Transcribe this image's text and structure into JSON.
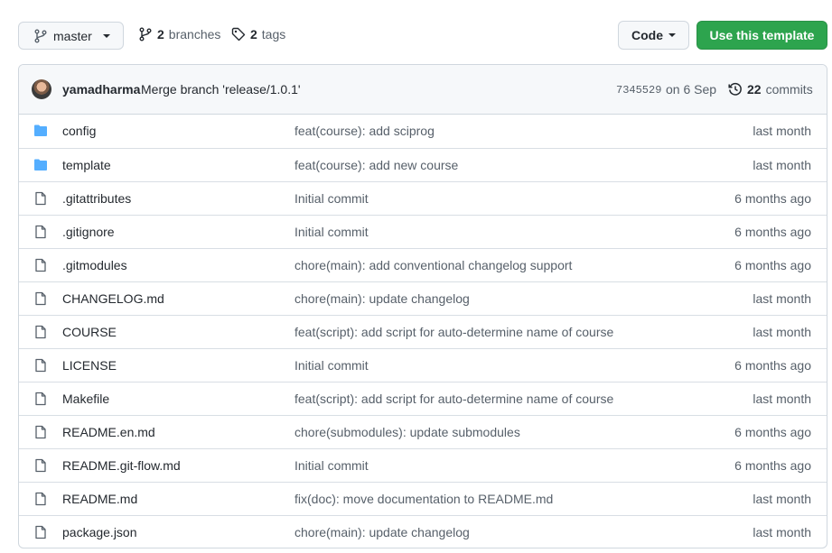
{
  "toolbar": {
    "branch": "master",
    "branches_count": "2",
    "branches_label": "branches",
    "tags_count": "2",
    "tags_label": "tags",
    "code_label": "Code",
    "template_label": "Use this template"
  },
  "latest_commit": {
    "author": "yamadharma",
    "message": "Merge branch 'release/1.0.1'",
    "sha": "7345529",
    "date": "on 6 Sep",
    "commits_count": "22",
    "commits_label": "commits"
  },
  "files": [
    {
      "name": "config",
      "type": "folder",
      "message": "feat(course): add sciprog",
      "age": "last month"
    },
    {
      "name": "template",
      "type": "folder",
      "message": "feat(course): add new course",
      "age": "last month"
    },
    {
      "name": ".gitattributes",
      "type": "file",
      "message": "Initial commit",
      "age": "6 months ago"
    },
    {
      "name": ".gitignore",
      "type": "file",
      "message": "Initial commit",
      "age": "6 months ago"
    },
    {
      "name": ".gitmodules",
      "type": "file",
      "message": "chore(main): add conventional changelog support",
      "age": "6 months ago"
    },
    {
      "name": "CHANGELOG.md",
      "type": "file",
      "message": "chore(main): update changelog",
      "age": "last month"
    },
    {
      "name": "COURSE",
      "type": "file",
      "message": "feat(script): add script for auto-determine name of course",
      "age": "last month"
    },
    {
      "name": "LICENSE",
      "type": "file",
      "message": "Initial commit",
      "age": "6 months ago"
    },
    {
      "name": "Makefile",
      "type": "file",
      "message": "feat(script): add script for auto-determine name of course",
      "age": "last month"
    },
    {
      "name": "README.en.md",
      "type": "file",
      "message": "chore(submodules): update submodules",
      "age": "6 months ago"
    },
    {
      "name": "README.git-flow.md",
      "type": "file",
      "message": "Initial commit",
      "age": "6 months ago"
    },
    {
      "name": "README.md",
      "type": "file",
      "message": "fix(doc): move documentation to README.md",
      "age": "last month"
    },
    {
      "name": "package.json",
      "type": "file",
      "message": "chore(main): update changelog",
      "age": "last month"
    }
  ],
  "colors": {
    "folder": "#54aeff",
    "file": "#57606a",
    "primary": "#2da44e"
  }
}
